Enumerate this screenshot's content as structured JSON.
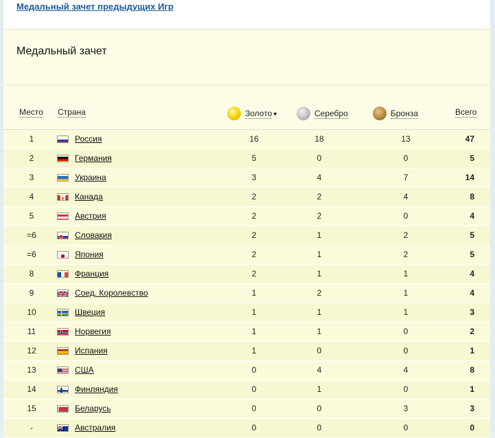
{
  "top": {
    "link": "Медальный зачет предыдущих Игр"
  },
  "section": {
    "title": "Медальный зачет"
  },
  "header": {
    "place": "Место",
    "country": "Страна",
    "gold": "Золото",
    "silver": "Серебро",
    "bronze": "Бронза",
    "total": "Всего",
    "sort_indicator": "▾"
  },
  "rows": [
    {
      "place": "1",
      "country": "Россия",
      "flag": "russia",
      "gold": "16",
      "silver": "18",
      "bronze": "13",
      "total": "47"
    },
    {
      "place": "2",
      "country": "Германия",
      "flag": "germany",
      "gold": "5",
      "silver": "0",
      "bronze": "0",
      "total": "5"
    },
    {
      "place": "3",
      "country": "Украина",
      "flag": "ukraine",
      "gold": "3",
      "silver": "4",
      "bronze": "7",
      "total": "14"
    },
    {
      "place": "4",
      "country": "Канада",
      "flag": "canada",
      "gold": "2",
      "silver": "2",
      "bronze": "4",
      "total": "8"
    },
    {
      "place": "5",
      "country": "Австрия",
      "flag": "austria",
      "gold": "2",
      "silver": "2",
      "bronze": "0",
      "total": "4"
    },
    {
      "place": "=6",
      "country": "Словакия",
      "flag": "slovakia",
      "gold": "2",
      "silver": "1",
      "bronze": "2",
      "total": "5"
    },
    {
      "place": "=6",
      "country": "Япония",
      "flag": "japan",
      "gold": "2",
      "silver": "1",
      "bronze": "2",
      "total": "5"
    },
    {
      "place": "8",
      "country": "Франция",
      "flag": "france",
      "gold": "2",
      "silver": "1",
      "bronze": "1",
      "total": "4"
    },
    {
      "place": "9",
      "country": "Соед. Королевство",
      "flag": "uk",
      "gold": "1",
      "silver": "2",
      "bronze": "1",
      "total": "4"
    },
    {
      "place": "10",
      "country": "Швеция",
      "flag": "sweden",
      "gold": "1",
      "silver": "1",
      "bronze": "1",
      "total": "3"
    },
    {
      "place": "11",
      "country": "Норвегия",
      "flag": "norway",
      "gold": "1",
      "silver": "1",
      "bronze": "0",
      "total": "2"
    },
    {
      "place": "12",
      "country": "Испания",
      "flag": "spain",
      "gold": "1",
      "silver": "0",
      "bronze": "0",
      "total": "1"
    },
    {
      "place": "13",
      "country": "США",
      "flag": "usa",
      "gold": "0",
      "silver": "4",
      "bronze": "4",
      "total": "8"
    },
    {
      "place": "14",
      "country": "Финляндия",
      "flag": "finland",
      "gold": "0",
      "silver": "1",
      "bronze": "0",
      "total": "1"
    },
    {
      "place": "15",
      "country": "Беларусь",
      "flag": "belarus",
      "gold": "0",
      "silver": "0",
      "bronze": "3",
      "total": "3"
    },
    {
      "place": "-",
      "country": "Австралия",
      "flag": "australia",
      "gold": "0",
      "silver": "0",
      "bronze": "0",
      "total": "0"
    }
  ],
  "colors": {
    "link": "#1a5a9a",
    "panel": "#fdfde7",
    "row_odd": "#fbfbdc",
    "row_even": "#f7f7d2"
  }
}
